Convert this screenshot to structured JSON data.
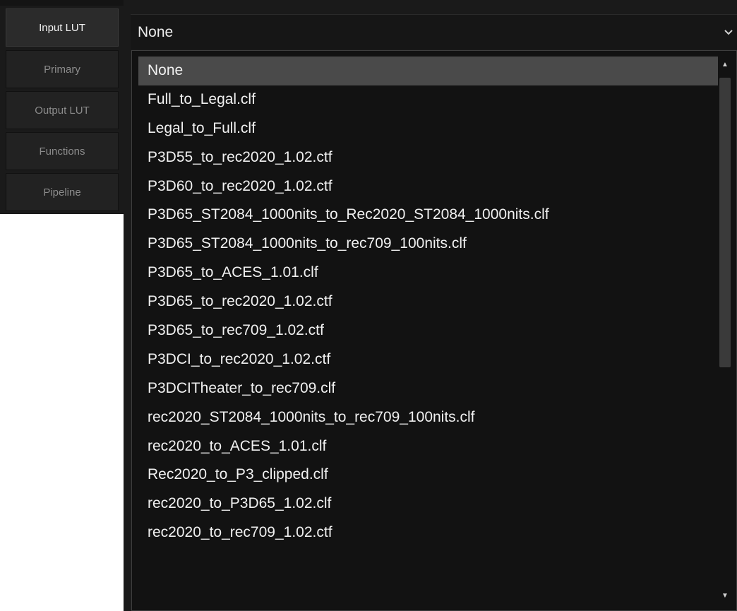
{
  "tabs": [
    {
      "label": "Input LUT",
      "active": true
    },
    {
      "label": "Primary",
      "active": false
    },
    {
      "label": "Output LUT",
      "active": false
    },
    {
      "label": "Functions",
      "active": false
    },
    {
      "label": "Pipeline",
      "active": false
    }
  ],
  "combo": {
    "value": "None",
    "arrow_icon": "chevron-down-icon"
  },
  "dropdown": {
    "selected_index": 0,
    "items": [
      "None",
      "Full_to_Legal.clf",
      "Legal_to_Full.clf",
      "P3D55_to_rec2020_1.02.ctf",
      "P3D60_to_rec2020_1.02.ctf",
      "P3D65_ST2084_1000nits_to_Rec2020_ST2084_1000nits.clf",
      "P3D65_ST2084_1000nits_to_rec709_100nits.clf",
      "P3D65_to_ACES_1.01.clf",
      "P3D65_to_rec2020_1.02.ctf",
      "P3D65_to_rec709_1.02.ctf",
      "P3DCI_to_rec2020_1.02.ctf",
      "P3DCITheater_to_rec709.clf",
      "rec2020_ST2084_1000nits_to_rec709_100nits.clf",
      "rec2020_to_ACES_1.01.clf",
      "Rec2020_to_P3_clipped.clf",
      "rec2020_to_P3D65_1.02.clf",
      "rec2020_to_rec709_1.02.ctf"
    ]
  },
  "scrollbar": {
    "up_icon": "scroll-up-arrow-icon",
    "down_icon": "scroll-down-arrow-icon",
    "up_glyph": "▲",
    "down_glyph": "▼"
  },
  "colors": {
    "panel_bg": "#1a1a1a",
    "list_bg": "#121212",
    "selected_bg": "#4a4a4a",
    "text": "#f0f0f0",
    "tab_inactive_text": "#8c8c8c"
  }
}
